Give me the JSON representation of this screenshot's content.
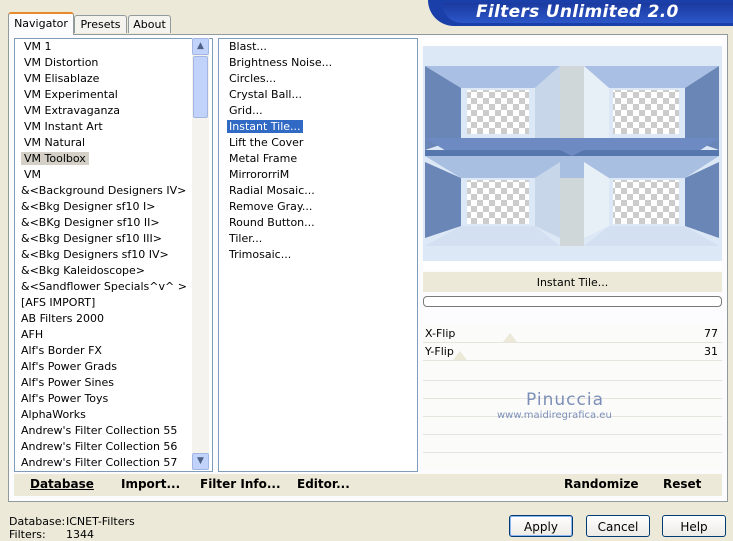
{
  "app": {
    "title": "Filters Unlimited 2.0"
  },
  "tabs": [
    {
      "label": "Navigator"
    },
    {
      "label": "Presets"
    },
    {
      "label": "About"
    }
  ],
  "categories": [
    "VM 1",
    "VM Distortion",
    "VM Elisablaze",
    "VM Experimental",
    "VM Extravaganza",
    "VM Instant Art",
    "VM Natural",
    "VM Toolbox",
    "VM",
    "&<Background Designers IV>",
    "&<Bkg Designer sf10 I>",
    "&<BKg Designer sf10 II>",
    "&<Bkg Designer sf10 III>",
    "&<Bkg Designers sf10 IV>",
    "&<Bkg Kaleidoscope>",
    "&<Sandflower Specials^v^ >",
    "[AFS IMPORT]",
    "AB Filters 2000",
    "AFH",
    "Alf's Border FX",
    "Alf's Power Grads",
    "Alf's Power Sines",
    "Alf's Power Toys",
    "AlphaWorks",
    "Andrew's Filter Collection 55",
    "Andrew's Filter Collection 56",
    "Andrew's Filter Collection 57"
  ],
  "selected_category": "VM Toolbox",
  "filters": [
    "Blast...",
    "Brightness Noise...",
    "Circles...",
    "Crystal Ball...",
    "Grid...",
    "Instant Tile...",
    "Lift the Cover",
    "Metal Frame",
    "MirrororriM",
    "Radial Mosaic...",
    "Remove Gray...",
    "Round Button...",
    "Tiler...",
    "Trimosaic..."
  ],
  "selected_filter": "Instant Tile...",
  "preview": {
    "filter_name": "Instant Tile...",
    "progress": 0
  },
  "parameters": [
    {
      "label": "X-Flip",
      "value": "77"
    },
    {
      "label": "Y-Flip",
      "value": "31"
    }
  ],
  "watermark": {
    "name": "Pinuccia",
    "site": "www.maidiregrafica.eu"
  },
  "panel_buttons": {
    "database": "Database",
    "import": "Import...",
    "filter_info": "Filter Info...",
    "editor": "Editor...",
    "randomize": "Randomize",
    "reset": "Reset"
  },
  "status": {
    "database_label": "Database:",
    "database_value": "ICNET-Filters",
    "filters_label": "Filters:",
    "filters_value": "1344"
  },
  "dialog_buttons": {
    "apply": "Apply",
    "cancel": "Cancel",
    "help": "Help"
  },
  "colors": {
    "selection": "#316ac5",
    "banner": "#1a3fa8",
    "accent_tab": "#e68b2c"
  }
}
